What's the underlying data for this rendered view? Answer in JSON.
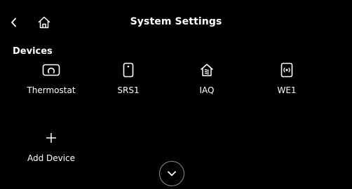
{
  "header": {
    "title": "System Settings",
    "back_icon": "chevron-left-icon",
    "home_icon": "home-icon"
  },
  "devices_section": {
    "label": "Devices",
    "items": [
      {
        "label": "Thermostat",
        "icon": "thermostat-icon"
      },
      {
        "label": "SRS1",
        "icon": "remote-sensor-icon"
      },
      {
        "label": "IAQ",
        "icon": "air-quality-icon"
      },
      {
        "label": "WE1",
        "icon": "wifi-extender-icon"
      }
    ],
    "add_device": {
      "label": "Add Device",
      "icon": "plus-icon"
    }
  },
  "scroll": {
    "icon": "chevron-down-icon"
  },
  "colors": {
    "background": "#000000",
    "text": "#ffffff",
    "scroll_border": "#8a8a8a"
  }
}
